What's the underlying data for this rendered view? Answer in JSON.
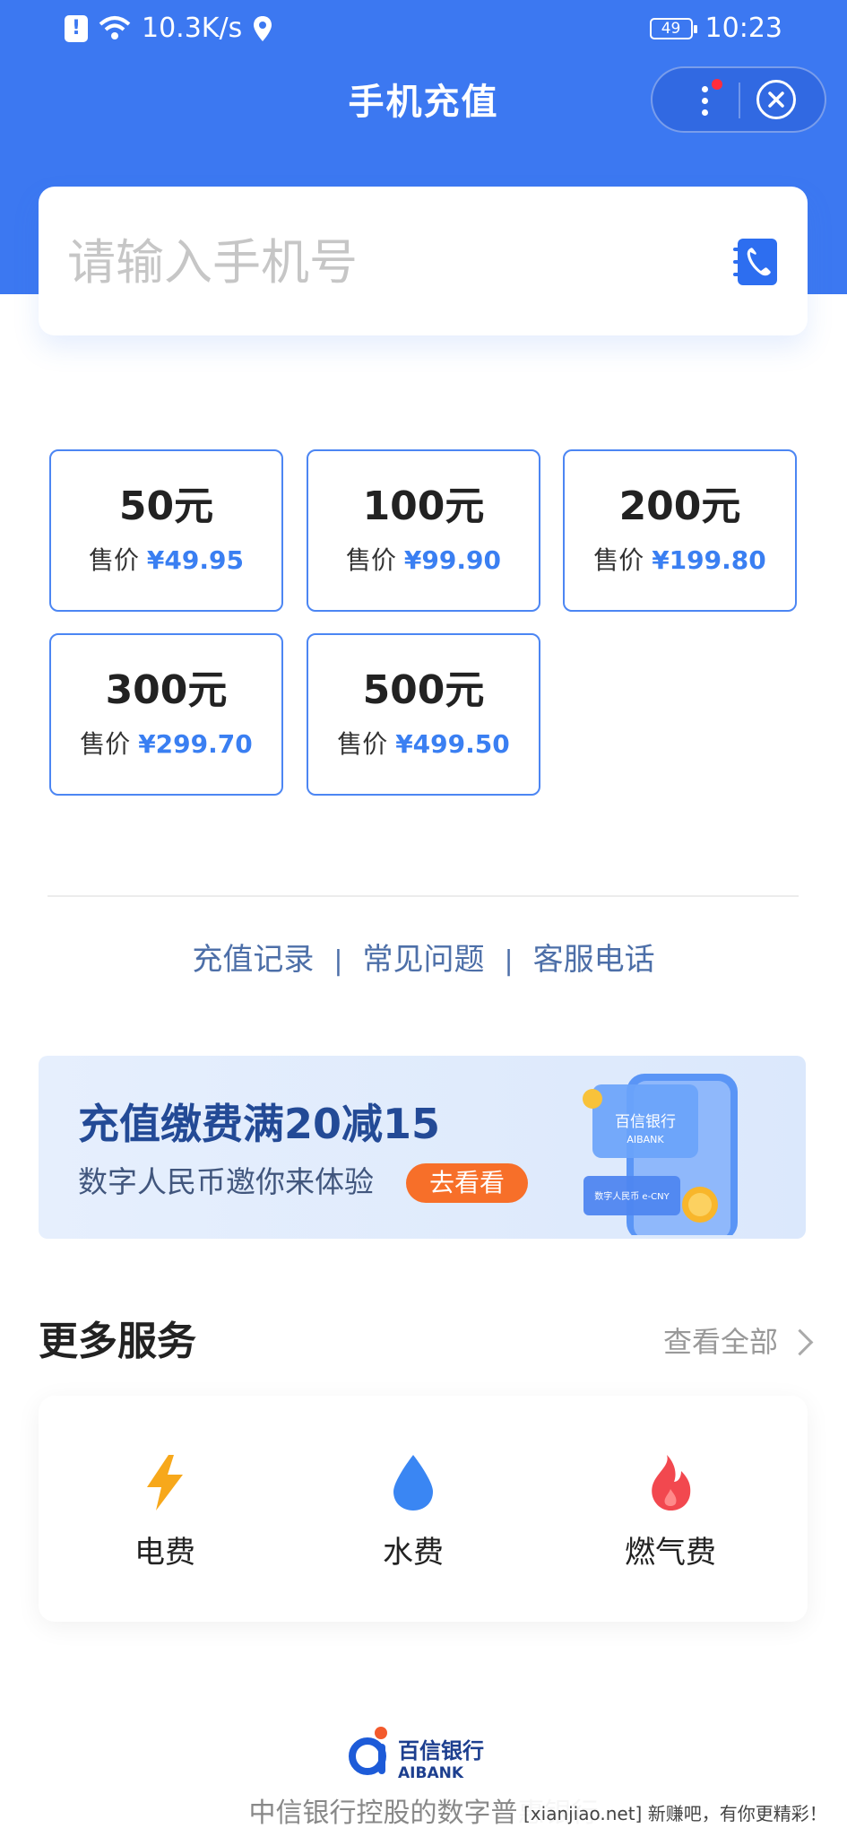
{
  "status_bar": {
    "net_speed": "10.3K/s",
    "battery": "49",
    "time": "10:23"
  },
  "nav": {
    "title": "手机充值"
  },
  "phone_input": {
    "placeholder": "请输入手机号"
  },
  "denominations": [
    {
      "amount": "50元",
      "price_label": "售价",
      "price": "¥49.95"
    },
    {
      "amount": "100元",
      "price_label": "售价",
      "price": "¥99.90"
    },
    {
      "amount": "200元",
      "price_label": "售价",
      "price": "¥199.80"
    },
    {
      "amount": "300元",
      "price_label": "售价",
      "price": "¥299.70"
    },
    {
      "amount": "500元",
      "price_label": "售价",
      "price": "¥499.50"
    }
  ],
  "links": {
    "items": [
      "充值记录",
      "常见问题",
      "客服电话"
    ],
    "separator": "|"
  },
  "banner": {
    "title": "充值缴费满20减15",
    "subtitle": "数字人民币邀你来体验",
    "button": "去看看",
    "card_brand": "百信银行",
    "card_brand_en": "AIBANK",
    "card_cny": "数字人民币 e-CNY"
  },
  "more_services": {
    "title": "更多服务",
    "view_all": "查看全部",
    "items": [
      {
        "label": "电费",
        "icon": "lightning-icon",
        "color": "#f7a81b"
      },
      {
        "label": "水费",
        "icon": "water-drop-icon",
        "color": "#3a86f3"
      },
      {
        "label": "燃气费",
        "icon": "flame-icon",
        "color": "#f2484f"
      }
    ]
  },
  "footer": {
    "brand": "百信银行",
    "brand_en": "AIBANK",
    "slogan": "中信银行控股的数字普惠银行",
    "watermark": "[xianjiao.net] 新赚吧，有你更精彩！"
  },
  "colors": {
    "primary": "#3c78f1",
    "price": "#3a7ff2",
    "banner_button": "#f76f29"
  }
}
